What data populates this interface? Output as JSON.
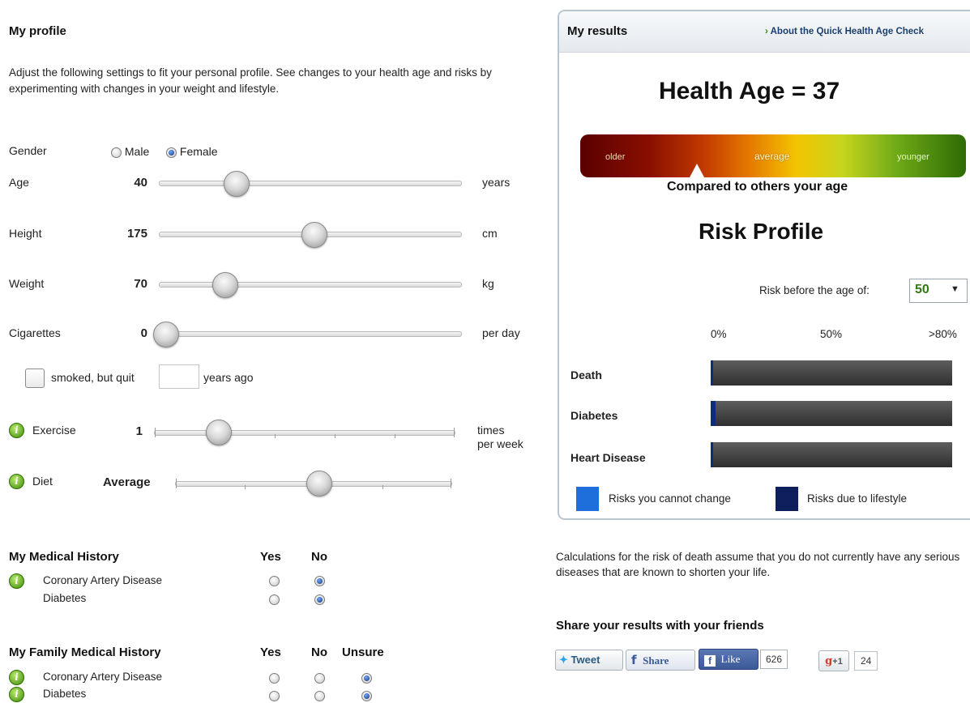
{
  "profile": {
    "title": "My profile",
    "intro": "Adjust the following settings to fit your personal profile. See changes to your health age and risks by experimenting with changes in your weight and lifestyle.",
    "gender": {
      "label": "Gender",
      "male": "Male",
      "female": "Female",
      "selected": "Female"
    },
    "age": {
      "label": "Age",
      "value": "40",
      "unit": "years"
    },
    "height": {
      "label": "Height",
      "value": "175",
      "unit": "cm"
    },
    "weight": {
      "label": "Weight",
      "value": "70",
      "unit": "kg"
    },
    "cigarettes": {
      "label": "Cigarettes",
      "value": "0",
      "unit": "per day"
    },
    "quit": {
      "label": "smoked, but quit",
      "suffix": "years ago",
      "value": ""
    },
    "exercise": {
      "label": "Exercise",
      "value": "1",
      "unit_line1": "times",
      "unit_line2": "per week"
    },
    "diet": {
      "label": "Diet",
      "value": "Average"
    }
  },
  "medical_history": {
    "title": "My Medical History",
    "col_yes": "Yes",
    "col_no": "No",
    "rows": [
      {
        "label": "Coronary Artery Disease",
        "selected": "No"
      },
      {
        "label": "Diabetes",
        "selected": "No"
      }
    ]
  },
  "family_history": {
    "title": "My Family Medical History",
    "col_yes": "Yes",
    "col_no": "No",
    "col_unsure": "Unsure",
    "rows": [
      {
        "label": "Coronary Artery Disease",
        "selected": "Unsure"
      },
      {
        "label": "Diabetes",
        "selected": "Unsure"
      }
    ]
  },
  "results": {
    "title": "My results",
    "about_link": "About the Quick Health Age Check",
    "health_age": "Health Age = 37",
    "scale": {
      "older": "older",
      "average": "average",
      "younger": "younger"
    },
    "compared": "Compared to others your age",
    "risk_title": "Risk Profile",
    "risk_before": "Risk before the age of:",
    "risk_age": "50",
    "axis": [
      "0%",
      "50%",
      ">80%"
    ],
    "risks": [
      {
        "label": "Death"
      },
      {
        "label": "Diabetes"
      },
      {
        "label": "Heart Disease"
      }
    ],
    "legend": {
      "cannot_change": "Risks you cannot change",
      "lifestyle": "Risks due to lifestyle"
    },
    "colors": {
      "cannot_change": "#1e6fdc",
      "lifestyle": "#0d1f5c"
    }
  },
  "note": "Calculations for the risk of death assume that you do not currently have any serious diseases that are known to shorten your life.",
  "share": {
    "title": "Share your results with your friends",
    "tweet": "Tweet",
    "share": "Share",
    "like": "Like",
    "like_count": "626",
    "gplus": "+1",
    "gplus_count": "24"
  }
}
